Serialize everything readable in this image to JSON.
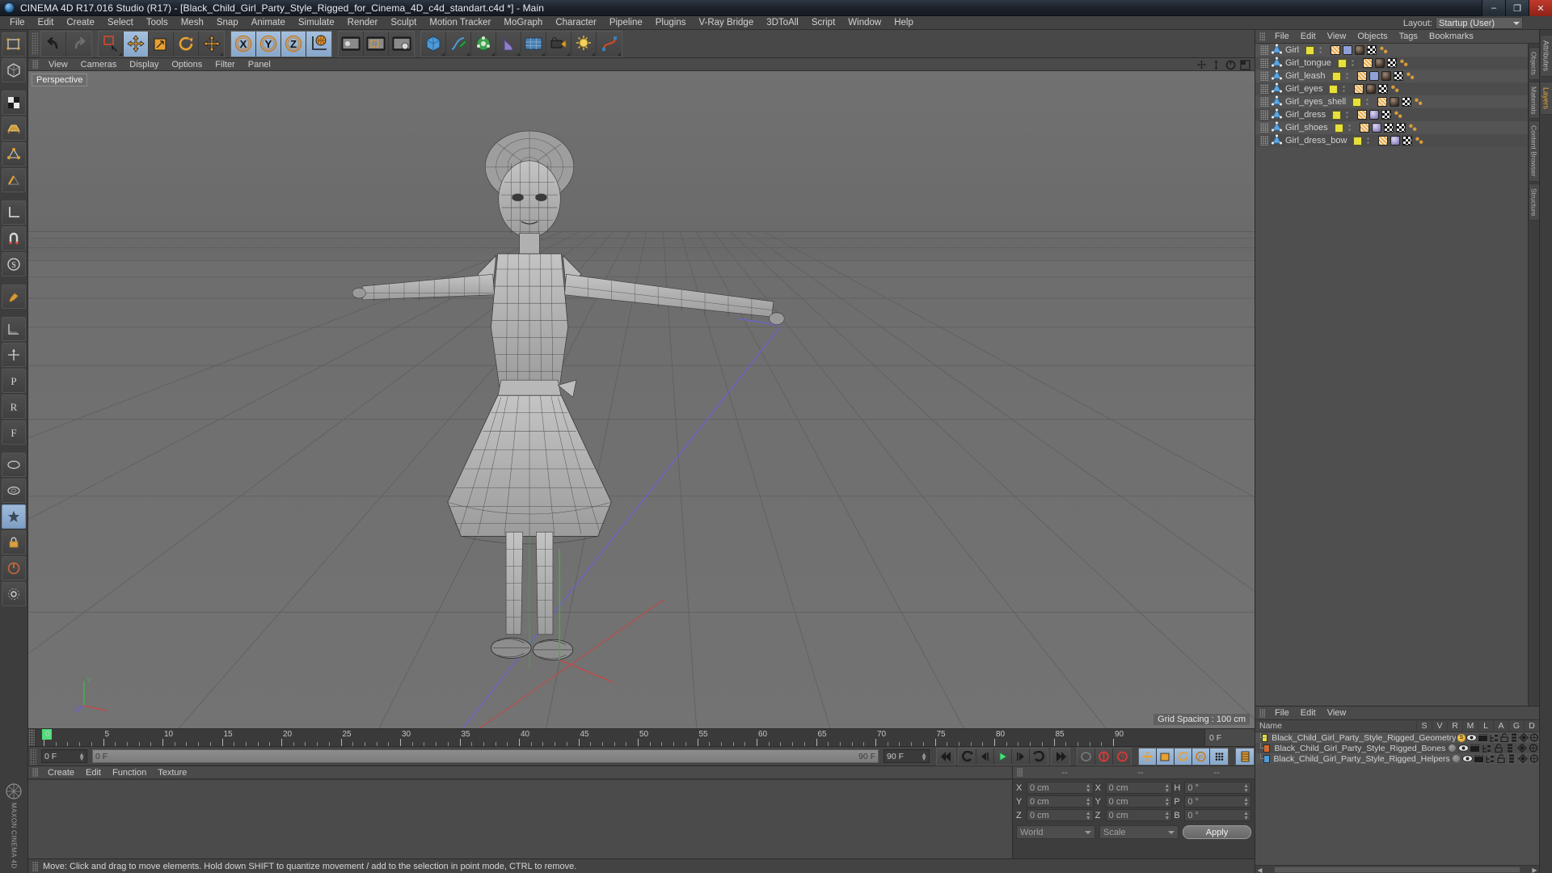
{
  "window": {
    "title": "CINEMA 4D R17.016 Studio (R17) - [Black_Child_Girl_Party_Style_Rigged_for_Cinema_4D_c4d_standart.c4d *] - Main",
    "minimize": "–",
    "maximize": "❐",
    "close": "✕"
  },
  "menu": {
    "items": [
      "File",
      "Edit",
      "Create",
      "Select",
      "Tools",
      "Mesh",
      "Snap",
      "Animate",
      "Simulate",
      "Render",
      "Sculpt",
      "Motion Tracker",
      "MoGraph",
      "Character",
      "Pipeline",
      "Plugins",
      "V-Ray Bridge",
      "3DToAll",
      "Script",
      "Window",
      "Help"
    ],
    "layout_label": "Layout:",
    "layout_value": "Startup (User)"
  },
  "toolbar": {
    "groups": [
      {
        "name": "undo-redo",
        "buttons": [
          {
            "name": "undo-button",
            "icon": "undo-arrow-icon"
          },
          {
            "name": "redo-button",
            "icon": "redo-arrow-icon"
          }
        ]
      },
      {
        "name": "selection-transform",
        "buttons": [
          {
            "name": "live-selection-button",
            "icon": "live-selection-icon"
          },
          {
            "name": "move-tool-button",
            "icon": "move-icon",
            "selected": true
          },
          {
            "name": "scale-tool-button",
            "icon": "scale-icon"
          },
          {
            "name": "rotate-tool-button",
            "icon": "rotate-icon"
          },
          {
            "name": "dynamic-place-button",
            "icon": "move-icon"
          }
        ]
      },
      {
        "name": "axis-locks",
        "buttons": [
          {
            "name": "x-axis-button",
            "icon": "x-axis-icon",
            "selected": true
          },
          {
            "name": "y-axis-button",
            "icon": "y-axis-icon",
            "selected": true
          },
          {
            "name": "z-axis-button",
            "icon": "z-axis-icon",
            "selected": true
          },
          {
            "name": "world-coordinates-button",
            "icon": "world-globe-icon",
            "selected": true
          }
        ]
      },
      {
        "name": "render-group",
        "buttons": [
          {
            "name": "render-view-button",
            "icon": "render-view-icon"
          },
          {
            "name": "render-region-button",
            "icon": "render-region-icon"
          },
          {
            "name": "render-settings-button",
            "icon": "render-settings-icon"
          }
        ]
      },
      {
        "name": "primitives-group",
        "buttons": [
          {
            "name": "cube-primitive-button",
            "icon": "cube-icon"
          },
          {
            "name": "spline-pen-button",
            "icon": "pen-icon"
          },
          {
            "name": "generator-button",
            "icon": "array-icon"
          },
          {
            "name": "deformer-button",
            "icon": "bend-icon"
          },
          {
            "name": "scene-object-button",
            "icon": "floor-icon"
          },
          {
            "name": "camera-button",
            "icon": "camera-icon"
          },
          {
            "name": "light-button",
            "icon": "light-icon"
          },
          {
            "name": "deformers-button",
            "icon": "deformer-icon"
          }
        ]
      }
    ]
  },
  "left_toolbar": {
    "tools": [
      {
        "name": "tool-editable-object",
        "icon": "make-editable-icon"
      },
      {
        "name": "tool-model-mode",
        "icon": "model-mode-icon"
      },
      {
        "name": "tool-texture-mode",
        "icon": "texture-mode-icon"
      },
      {
        "name": "tool-polygon-mode",
        "icon": "polygon-mode-icon"
      },
      {
        "name": "tool-point-mode",
        "icon": "point-mode-icon"
      },
      {
        "name": "tool-edge-mode",
        "icon": "edge-mode-icon"
      },
      {
        "name": "tool-object-axis",
        "icon": "object-axis-icon"
      },
      {
        "name": "tool-viewport-solo",
        "icon": "viewport-solo-icon"
      },
      {
        "name": "tool-snap",
        "icon": "magnet-icon"
      },
      {
        "name": "tool-workplane",
        "icon": "workplane-icon"
      },
      {
        "name": "tool-brush",
        "icon": "brush-icon"
      },
      {
        "name": "tool-layer",
        "icon": "layer-icon"
      },
      {
        "name": "tool-axis-lock",
        "icon": "axis-lock-icon"
      },
      {
        "name": "tool-gizmo",
        "icon": "gizmo-icon"
      },
      {
        "name": "tool-knife",
        "icon": "knife-icon"
      },
      {
        "name": "tool-loop",
        "icon": "loop-icon"
      },
      {
        "name": "tool-bevel",
        "icon": "bevel-icon"
      },
      {
        "name": "tool-lock",
        "icon": "lock-icon"
      },
      {
        "name": "tool-power",
        "icon": "power-icon"
      },
      {
        "name": "tool-interaction",
        "icon": "interaction-icon"
      }
    ],
    "brand": "MAXON",
    "brand_sub": "CINEMA 4D"
  },
  "viewport": {
    "menu": [
      "View",
      "Cameras",
      "Display",
      "Options",
      "Filter",
      "Panel"
    ],
    "label": "Perspective",
    "grid_spacing": "Grid Spacing : 100 cm",
    "nav_icons": [
      "pan-icon",
      "zoom-icon",
      "rotate-icon",
      "maximize-viewport-icon"
    ],
    "axes": {
      "x": "X",
      "y": "Y",
      "z": "Z"
    }
  },
  "timeline": {
    "ticks": [
      0,
      5,
      10,
      15,
      20,
      25,
      30,
      35,
      40,
      45,
      50,
      55,
      60,
      65,
      70,
      75,
      80,
      85,
      90
    ],
    "end_field": "0 F",
    "current_frame": "0 F",
    "current_frame_field": "0 F",
    "range_start": "0 F",
    "range_end": "90 F",
    "max_frame": "90 F",
    "preview_end": "90 F"
  },
  "playback": {
    "buttons": [
      {
        "name": "go-to-start-button",
        "icon": "skip-start-icon"
      },
      {
        "name": "step-back-keyframe-button",
        "icon": "prev-key-icon"
      },
      {
        "name": "step-back-frame-button",
        "icon": "prev-frame-icon"
      },
      {
        "name": "play-button",
        "icon": "play-icon"
      },
      {
        "name": "step-forward-frame-button",
        "icon": "next-frame-icon"
      },
      {
        "name": "step-forward-keyframe-button",
        "icon": "next-key-icon"
      },
      {
        "name": "go-to-end-button",
        "icon": "skip-end-icon"
      }
    ],
    "record_buttons": [
      {
        "name": "autokey-button",
        "icon": "key-icon"
      },
      {
        "name": "record-active-objects-button",
        "icon": "record-icon"
      },
      {
        "name": "record-question-button",
        "icon": "record-question-icon"
      }
    ],
    "key_toggles": [
      {
        "name": "key-position-button",
        "icon": "position-key-icon",
        "selected": true
      },
      {
        "name": "key-scale-button",
        "icon": "scale-key-icon",
        "selected": true
      },
      {
        "name": "key-rotation-button",
        "icon": "rotation-key-icon",
        "selected": true
      },
      {
        "name": "key-param-button",
        "icon": "param-key-icon",
        "selected": true
      },
      {
        "name": "key-pla-button",
        "icon": "pla-key-icon",
        "selected": true
      },
      {
        "name": "timeline-button",
        "icon": "timeline-icon",
        "selected": true
      }
    ]
  },
  "material_manager": {
    "menu": [
      "Create",
      "Edit",
      "Function",
      "Texture"
    ]
  },
  "coordinates": {
    "header": [
      "--",
      "--",
      "--"
    ],
    "rows": [
      {
        "pos_label": "X",
        "pos_value": "0 cm",
        "size_label": "X",
        "size_value": "0 cm",
        "rot_label": "H",
        "rot_value": "0 °"
      },
      {
        "pos_label": "Y",
        "pos_value": "0 cm",
        "size_label": "Y",
        "size_value": "0 cm",
        "rot_label": "P",
        "rot_value": "0 °"
      },
      {
        "pos_label": "Z",
        "pos_value": "0 cm",
        "size_label": "Z",
        "size_value": "0 cm",
        "rot_label": "B",
        "rot_value": "0 °"
      }
    ],
    "coord_system": "World",
    "size_mode": "Scale",
    "apply_label": "Apply"
  },
  "status_bar": {
    "text": "Move: Click and drag to move elements. Hold down SHIFT to quantize movement / add to the selection in point mode, CTRL to remove."
  },
  "object_manager": {
    "menu": [
      "File",
      "Edit",
      "View",
      "Objects",
      "Tags",
      "Bookmarks"
    ],
    "objects": [
      {
        "name": "Girl",
        "swatch": "#e8e03a",
        "tags": [
          "selection",
          "weight",
          "mat-dark",
          "checker",
          "point"
        ]
      },
      {
        "name": "Girl_tongue",
        "swatch": "#e8e03a",
        "tags": [
          "selection",
          "mat-dark",
          "checker",
          "point"
        ]
      },
      {
        "name": "Girl_leash",
        "swatch": "#e8e03a",
        "tags": [
          "selection",
          "weight",
          "mat-dark",
          "checker",
          "point"
        ]
      },
      {
        "name": "Girl_eyes",
        "swatch": "#e8e03a",
        "tags": [
          "selection",
          "mat-dark",
          "checker",
          "point"
        ]
      },
      {
        "name": "Girl_eyes_shell",
        "swatch": "#e8e03a",
        "tags": [
          "selection",
          "mat-dark",
          "checker",
          "point"
        ]
      },
      {
        "name": "Girl_dress",
        "swatch": "#e8e03a",
        "tags": [
          "selection",
          "mat-purple",
          "checker",
          "point"
        ]
      },
      {
        "name": "Girl_shoes",
        "swatch": "#e8e03a",
        "tags": [
          "selection",
          "mat-purple",
          "checker",
          "checker2",
          "point"
        ]
      },
      {
        "name": "Girl_dress_bow",
        "swatch": "#e8e03a",
        "tags": [
          "selection",
          "mat-purple",
          "checker",
          "point"
        ]
      }
    ],
    "side_tabs": [
      "Objects",
      "Materials",
      "Content Browser",
      "Structure"
    ]
  },
  "layer_manager": {
    "menu": [
      "File",
      "Edit",
      "View"
    ],
    "name_header": "Name",
    "columns": [
      "S",
      "V",
      "R",
      "M",
      "L",
      "A",
      "G",
      "D"
    ],
    "layers": [
      {
        "name": "Black_Child_Girl_Party_Style_Rigged_Geometry",
        "color": "#e8e03a",
        "solo": true
      },
      {
        "name": "Black_Child_Girl_Party_Style_Rigged_Bones",
        "color": "#d4682e",
        "solo": false
      },
      {
        "name": "Black_Child_Girl_Party_Style_Rigged_Helpers",
        "color": "#4e9cd8",
        "solo": false
      }
    ],
    "side_tabs": [
      "Attributes",
      "Layers"
    ]
  }
}
